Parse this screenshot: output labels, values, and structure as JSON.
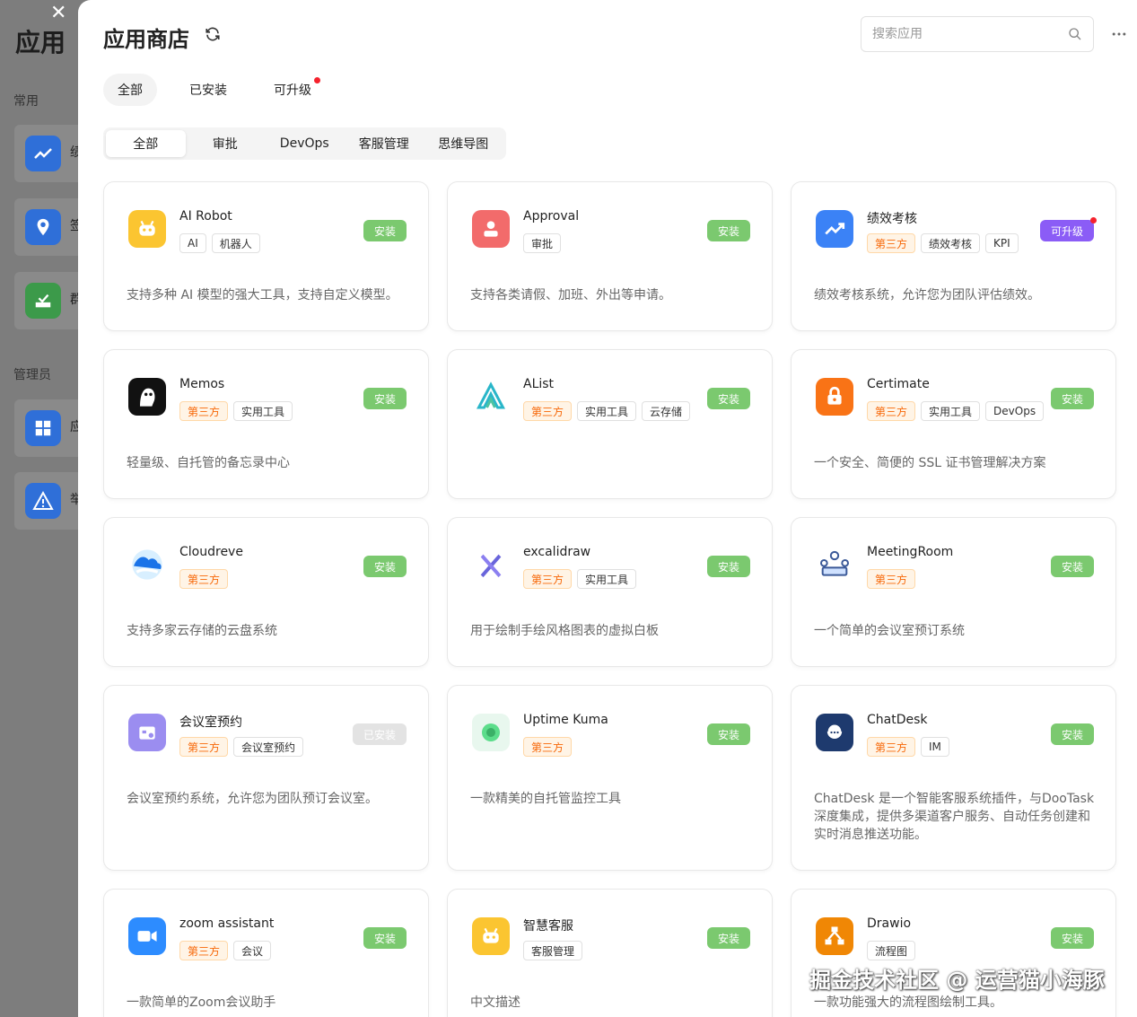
{
  "background": {
    "title": "应用",
    "close_symbol": "✕",
    "sections": [
      "常用",
      "管理员"
    ],
    "items": [
      {
        "label": "绩",
        "color": "#2f6fd8"
      },
      {
        "label": "签",
        "color": "#2f6fd8"
      },
      {
        "label": "群",
        "color": "#3c9a4a"
      },
      {
        "label": "应",
        "color": "#2f6fd8"
      },
      {
        "label": "举",
        "color": "#2f6fd8"
      }
    ]
  },
  "header": {
    "title": "应用商店",
    "search_placeholder": "搜索应用"
  },
  "status_tabs": [
    "全部",
    "已安装",
    "可升级"
  ],
  "category_tabs": [
    "全部",
    "审批",
    "DevOps",
    "客服管理",
    "思维导图"
  ],
  "apps": [
    {
      "name": "AI Robot",
      "tags": [
        "AI",
        "机器人"
      ],
      "third": false,
      "action": "安装",
      "status": "install",
      "desc": "支持多种 AI 模型的强大工具，支持自定义模型。",
      "icon": "robot-icon",
      "color": "#fbc531"
    },
    {
      "name": "Approval",
      "tags": [
        "审批"
      ],
      "third": false,
      "action": "安装",
      "status": "install",
      "desc": "支持各类请假、加班、外出等申请。",
      "icon": "approval-icon",
      "color": "#f26b6b"
    },
    {
      "name": "绩效考核",
      "tags": [
        "第三方",
        "绩效考核",
        "KPI"
      ],
      "third": true,
      "action": "可升级",
      "status": "upgrade",
      "desc": "绩效考核系统，允许您为团队评估绩效。",
      "icon": "chart-icon",
      "color": "#3b82f6"
    },
    {
      "name": "Memos",
      "tags": [
        "第三方",
        "实用工具"
      ],
      "third": true,
      "action": "安装",
      "status": "install",
      "desc": "轻量级、自托管的备忘录中心",
      "icon": "memos-icon",
      "color": "#111111"
    },
    {
      "name": "AList",
      "tags": [
        "第三方",
        "实用工具",
        "云存储"
      ],
      "third": true,
      "action": "安装",
      "status": "install",
      "desc": "",
      "icon": "alist-icon",
      "color": "#ffffff"
    },
    {
      "name": "Certimate",
      "tags": [
        "第三方",
        "实用工具",
        "DevOps"
      ],
      "third": true,
      "action": "安装",
      "status": "install",
      "desc": "一个安全、简便的 SSL 证书管理解决方案",
      "icon": "lock-icon",
      "color": "#f97316"
    },
    {
      "name": "Cloudreve",
      "tags": [
        "第三方"
      ],
      "third": true,
      "action": "安装",
      "status": "install",
      "desc": "支持多家云存储的云盘系统",
      "icon": "cloud-icon",
      "color": "#ffffff"
    },
    {
      "name": "excalidraw",
      "tags": [
        "第三方",
        "实用工具"
      ],
      "third": true,
      "action": "安装",
      "status": "install",
      "desc": "用于绘制手绘风格图表的虚拟白板",
      "icon": "pencil-icon",
      "color": "#ffffff"
    },
    {
      "name": "MeetingRoom",
      "tags": [
        "第三方"
      ],
      "third": true,
      "action": "安装",
      "status": "install",
      "desc": "一个简单的会议室预订系统",
      "icon": "meeting-icon",
      "color": "#ffffff"
    },
    {
      "name": "会议室预约",
      "tags": [
        "第三方",
        "会议室预约"
      ],
      "third": true,
      "action": "已安装",
      "status": "installed",
      "desc": "会议室预约系统，允许您为团队预订会议室。",
      "icon": "calendar-icon",
      "color": "#9b8df0"
    },
    {
      "name": "Uptime Kuma",
      "tags": [
        "第三方"
      ],
      "third": true,
      "action": "安装",
      "status": "install",
      "desc": "一款精美的自托管监控工具",
      "icon": "kuma-icon",
      "color": "#e8f7ee"
    },
    {
      "name": "ChatDesk",
      "tags": [
        "第三方",
        "IM"
      ],
      "third": true,
      "action": "安装",
      "status": "install",
      "desc": "ChatDesk 是一个智能客服系统插件，与DooTask 深度集成，提供多渠道客户服务、自动任务创建和实时消息推送功能。",
      "icon": "chat-icon",
      "color": "#1e3a6e"
    },
    {
      "name": "zoom assistant",
      "tags": [
        "第三方",
        "会议"
      ],
      "third": true,
      "action": "安装",
      "status": "install",
      "desc": "一款简单的Zoom会议助手",
      "icon": "zoom-icon",
      "color": "#2d8cff"
    },
    {
      "name": "智慧客服",
      "tags": [
        "客服管理"
      ],
      "third": false,
      "action": "安装",
      "status": "install",
      "desc": "中文描述",
      "icon": "robot-icon",
      "color": "#fbc531"
    },
    {
      "name": "Drawio",
      "tags": [
        "流程图"
      ],
      "third": false,
      "action": "安装",
      "status": "install",
      "desc": "一款功能强大的流程图绘制工具。",
      "icon": "drawio-icon",
      "color": "#f08705"
    }
  ],
  "watermark": "掘金技术社区 @ 运营猫小海豚"
}
